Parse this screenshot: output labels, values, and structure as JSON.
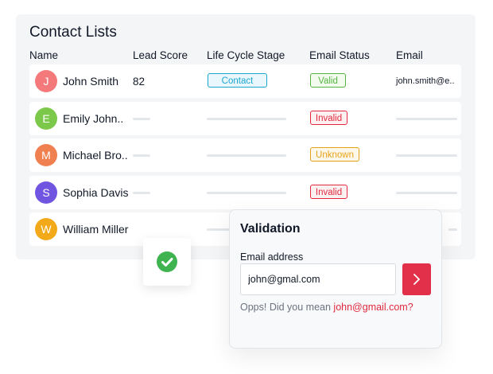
{
  "title": "Contact Lists",
  "columns": {
    "name": "Name",
    "lead_score": "Lead Score",
    "life_cycle_stage": "Life Cycle Stage",
    "email_status": "Email Status",
    "email": "Email"
  },
  "rows": [
    {
      "initial": "J",
      "name": "John Smith",
      "avatar_color": "#f4797a",
      "lead_score": "82",
      "stage": "Contact",
      "email_status": "Valid",
      "email": "john.smith@e.."
    },
    {
      "initial": "E",
      "name": "Emily John..",
      "avatar_color": "#7cc84b",
      "email_status": "Invalid"
    },
    {
      "initial": "M",
      "name": "Michael Bro..",
      "avatar_color": "#f08050",
      "email_status": "Unknown"
    },
    {
      "initial": "S",
      "name": "Sophia Davis",
      "avatar_color": "#6f55e0",
      "email_status": "Invalid"
    },
    {
      "initial": "W",
      "name": "William Miller",
      "avatar_color": "#f2a91a"
    }
  ],
  "validation": {
    "title": "Validation",
    "email_label": "Email address",
    "email_value": "john@gmal.com",
    "hint_prefix": "Opps! Did you mean ",
    "suggestion": "john@gmail.com",
    "hint_suffix": "?",
    "submit_icon": "chevron-right-icon"
  },
  "check_badge_icon": "check-circle-icon",
  "colors": {
    "accent_red": "#e2304a",
    "valid_green": "#55b542",
    "contact_blue": "#1aa6cf",
    "unknown_orange": "#e6a11b"
  }
}
